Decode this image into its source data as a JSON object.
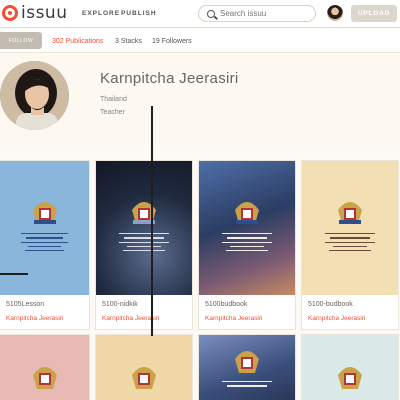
{
  "header": {
    "logo_text": "issuu",
    "nav": [
      "EXPLORE",
      "PUBLISH"
    ],
    "search_placeholder": "Search issuu",
    "upload_label": "UPLOAD"
  },
  "stats": {
    "follow_label": "FOLLOW",
    "publications": "302 Publications",
    "stacks": "3 Stacks",
    "followers": "19 Followers"
  },
  "profile": {
    "name": "Karnpitcha Jeerasiri",
    "location": "Thailand",
    "bio": "Teacher"
  },
  "publications": [
    {
      "title": "5105Lesson",
      "author": "Karnpitcha Jeerasiri",
      "cover": "#8bb6dc",
      "ink": "#2f4f8a"
    },
    {
      "title": "5100-nidkik",
      "author": "Karnpitcha Jeerasiri",
      "cover": "#202a3f",
      "ink": "#d9dde6"
    },
    {
      "title": "5100budbook",
      "author": "Karnpitcha Jeerasiri",
      "cover": "#3f5a8a",
      "ink": "#f2eee6"
    },
    {
      "title": "5100-budbook",
      "author": "Karnpitcha Jeerasiri",
      "cover": "#f3dfb4",
      "ink": "#6b4b3b"
    }
  ],
  "colors": {
    "accent": "#f04e37",
    "background": "#fdf8f0"
  }
}
